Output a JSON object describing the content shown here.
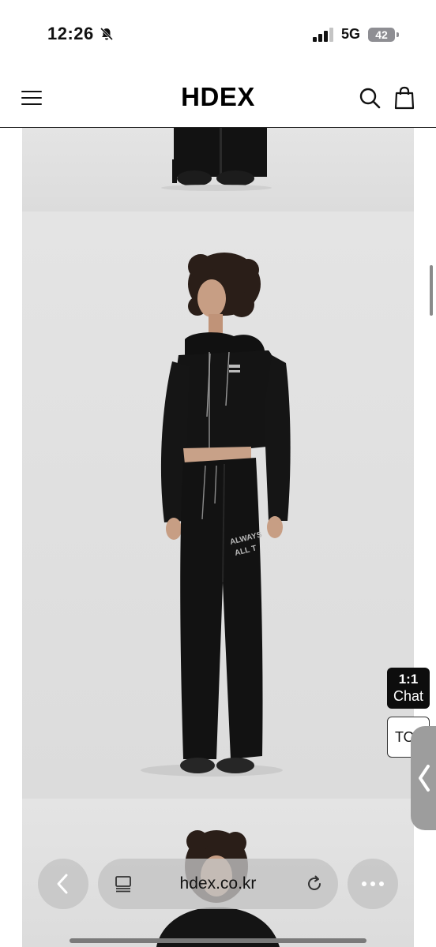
{
  "status_bar": {
    "time": "12:26",
    "silent_icon": "bell-slash-icon",
    "signal_icon": "cellular-signal-icon",
    "network": "5G",
    "battery": "42"
  },
  "header": {
    "logo": "HDEX",
    "menu_icon": "hamburger-menu-icon",
    "search_icon": "search-icon",
    "cart_icon": "shopping-bag-icon"
  },
  "product_images": {
    "garment_print_line1": "ALWAYS",
    "garment_print_line2": "ALL T"
  },
  "floating": {
    "chat_line1": "1:1",
    "chat_line2": "Chat",
    "top_label": "TOP",
    "back_icon": "chevron-left-icon"
  },
  "browser_bar": {
    "back_icon": "chevron-left-icon",
    "url": "hdex.co.kr",
    "reader_icon": "reader-list-icon",
    "reload_icon": "reload-icon",
    "more_icon": "more-dots-icon"
  },
  "colors": {
    "accent_dark": "#0d0d0d",
    "backdrop": "#e0e0e0"
  }
}
